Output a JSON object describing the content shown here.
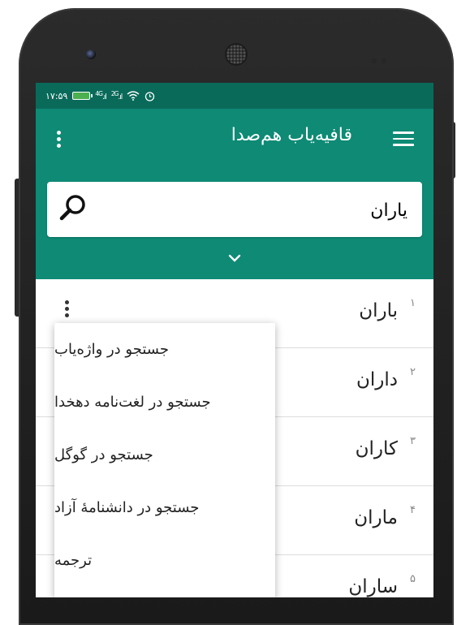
{
  "status": {
    "time": "۱۷:۵۹",
    "net1": "4G",
    "net2": "2G"
  },
  "appbar": {
    "title": "قافیه‌یاب هم‌صدا"
  },
  "search": {
    "value": "یاران"
  },
  "results": [
    {
      "index": "۱",
      "word": "باران"
    },
    {
      "index": "۲",
      "word": "داران"
    },
    {
      "index": "۳",
      "word": "کاران"
    },
    {
      "index": "۴",
      "word": "ماران"
    },
    {
      "index": "۵",
      "word": "ساران"
    }
  ],
  "menu": {
    "items": [
      "جستجو در واژه‌یاب",
      "جستجو در لغت‌نامه دهخدا",
      "جستجو در گوگل",
      "جستجو در دانشنامهٔ آزاد",
      "ترجمه"
    ]
  },
  "colors": {
    "primary": "#0e8a75",
    "status": "#0a6a5a"
  },
  "icons": [
    "menu-icon",
    "overflow-icon",
    "search-icon",
    "chevron-down-icon",
    "battery-icon",
    "signal-icon",
    "wifi-icon",
    "alarm-icon"
  ]
}
